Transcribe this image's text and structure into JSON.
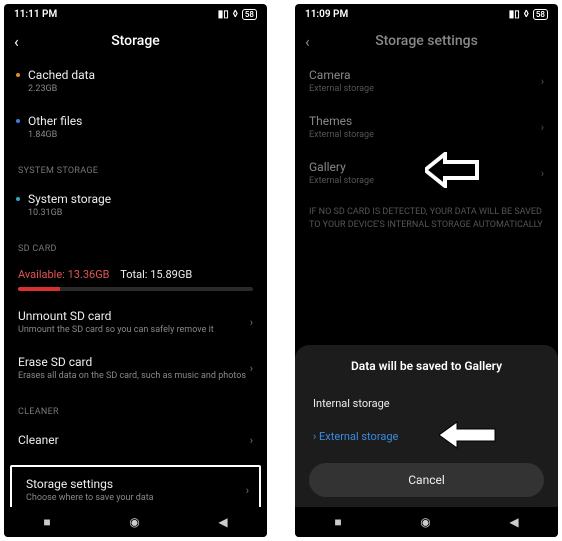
{
  "left": {
    "statusbar": {
      "time": "11:11 PM",
      "battery": "58"
    },
    "header": {
      "title": "Storage"
    },
    "cached": {
      "title": "Cached data",
      "sub": "2.23GB"
    },
    "other": {
      "title": "Other files",
      "sub": "1.84GB"
    },
    "sections": {
      "system": "SYSTEM STORAGE",
      "sdcard": "SD CARD",
      "cleaner": "CLEANER"
    },
    "system_storage": {
      "title": "System storage",
      "sub": "10.31GB"
    },
    "sd_available_label": "Available:",
    "sd_available_value": "13.36GB",
    "sd_total_label": "Total:",
    "sd_total_value": "15.89GB",
    "unmount": {
      "title": "Unmount SD card",
      "sub": "Unmount the SD card so you can safely remove it"
    },
    "erase": {
      "title": "Erase SD card",
      "sub": "Erases all data on the SD card, such as music and photos"
    },
    "cleaner": {
      "title": "Cleaner"
    },
    "storage_settings": {
      "title": "Storage settings",
      "sub": "Choose where to save your data"
    }
  },
  "right": {
    "statusbar": {
      "time": "11:09 PM",
      "battery": "58"
    },
    "header": {
      "title": "Storage settings"
    },
    "camera": {
      "title": "Camera",
      "sub": "External storage"
    },
    "themes": {
      "title": "Themes",
      "sub": "External storage"
    },
    "gallery": {
      "title": "Gallery",
      "sub": "External storage"
    },
    "note": "IF NO SD CARD IS DETECTED, YOUR DATA WILL BE SAVED TO YOUR DEVICE'S INTERNAL STORAGE AUTOMATICALLY",
    "sheet": {
      "title": "Data will be saved to Gallery",
      "option_internal": "Internal storage",
      "option_external": "External storage",
      "cancel": "Cancel"
    }
  }
}
